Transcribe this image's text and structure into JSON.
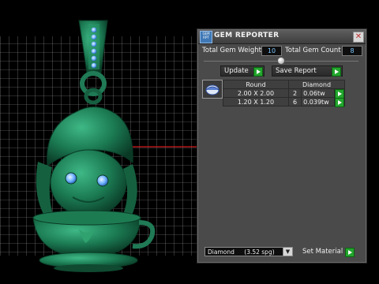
{
  "viewport": {
    "grid_color": "#a0a0a0",
    "axis_color": "#d01818",
    "model_color": "#1f7a55",
    "gem_color": "#5aa8ff"
  },
  "panel": {
    "title": "GEM REPORTER",
    "app_icon_text": "GEM RPT",
    "close_glyph": "✕",
    "total_weight_label": "Total Gem Weight",
    "total_weight_value": "10",
    "total_count_label": "Total Gem Count",
    "total_count_value": "8",
    "update_label": "Update",
    "save_report_label": "Save Report",
    "table": {
      "headers": [
        "Round",
        "Diamond"
      ],
      "rows": [
        {
          "size": "2.00 X 2.00",
          "count": "2",
          "weight": "0.06tw"
        },
        {
          "size": "1.20 X 1.20",
          "count": "6",
          "weight": "0.039tw"
        }
      ]
    },
    "material_select": {
      "value": "Diamond",
      "density": "(3.52 spg)",
      "arrow": "▼"
    },
    "set_material_label": "Set Material",
    "accent_green": "#23a62d"
  }
}
